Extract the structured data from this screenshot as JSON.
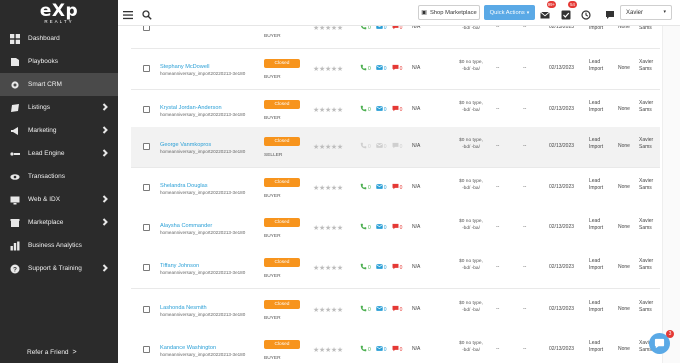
{
  "brand": {
    "logo_main": "eXp",
    "logo_sub": "REALTY"
  },
  "sidebar": {
    "items": [
      {
        "label": "Dashboard",
        "icon": "dashboard-icon",
        "chevron": false,
        "active": false
      },
      {
        "label": "Playbooks",
        "icon": "book-icon",
        "chevron": false,
        "active": false
      },
      {
        "label": "Smart CRM",
        "icon": "gear-icon",
        "chevron": false,
        "active": true
      },
      {
        "label": "Listings",
        "icon": "home-icon",
        "chevron": true,
        "active": false
      },
      {
        "label": "Marketing",
        "icon": "megaphone-icon",
        "chevron": true,
        "active": false
      },
      {
        "label": "Lead Engine",
        "icon": "funnel-icon",
        "chevron": true,
        "active": false
      },
      {
        "label": "Transactions",
        "icon": "eye-icon",
        "chevron": false,
        "active": false
      },
      {
        "label": "Web & IDX",
        "icon": "globe-icon",
        "chevron": true,
        "active": false
      },
      {
        "label": "Marketplace",
        "icon": "store-icon",
        "chevron": true,
        "active": false
      },
      {
        "label": "Business Analytics",
        "icon": "bar-chart-icon",
        "chevron": false,
        "active": false
      },
      {
        "label": "Support & Training",
        "icon": "question-icon",
        "chevron": true,
        "active": false
      }
    ],
    "refer_label": "Refer a Friend",
    "refer_arrow": ">"
  },
  "topbar": {
    "shop_label": "Shop Marketplace",
    "quick_label": "Quick Actions",
    "mail_badge": "99+",
    "tasks_badge": "54",
    "user_name": "Xavier"
  },
  "table": {
    "rows": [
      {
        "name": "",
        "sub": "homeanniversary_import20220213-3e180",
        "status": "",
        "role": "BUYER",
        "type_line1": "$0 no type,",
        "type_line2": "-bd/ -ba/",
        "na": "N/A",
        "dash1": "--",
        "dash2": "--",
        "date": "02/13/2023",
        "source_line1": "Lead",
        "source_line2": "Import",
        "owner": "None",
        "agent_line1": "Xavier",
        "agent_line2": "Sams"
      },
      {
        "name": "Stephany McDowell",
        "sub": "homeanniversary_import20220213-3e180",
        "status": "Closed",
        "role": "BUYER",
        "type_line1": "$0 no type,",
        "type_line2": "-bd/ -ba/",
        "na": "N/A",
        "dash1": "--",
        "dash2": "--",
        "date": "02/13/2023",
        "source_line1": "Lead",
        "source_line2": "Import",
        "owner": "None",
        "agent_line1": "Xavier",
        "agent_line2": "Sams"
      },
      {
        "name": "Krystal Jordan-Anderson",
        "sub": "homeanniversary_import20220213-3e180",
        "status": "Closed",
        "role": "BUYER",
        "type_line1": "$0 no type,",
        "type_line2": "-bd/ -ba/",
        "na": "N/A",
        "dash1": "--",
        "dash2": "--",
        "date": "02/13/2023",
        "source_line1": "Lead",
        "source_line2": "Import",
        "owner": "None",
        "agent_line1": "Xavier",
        "agent_line2": "Sams"
      },
      {
        "name": "George Vanmkopros",
        "sub": "homeanniversary_import20220213-3e180",
        "status": "Closed",
        "role": "SELLER",
        "type_line1": "$0 no type,",
        "type_line2": "-bd/ -ba/",
        "na": "N/A",
        "dash1": "--",
        "dash2": "--",
        "date": "02/13/2023",
        "source_line1": "Lead",
        "source_line2": "Import",
        "owner": "None",
        "agent_line1": "Xavier",
        "agent_line2": "Sams"
      },
      {
        "name": "Shelandra Douglas",
        "sub": "homeanniversary_import20220213-3e180",
        "status": "Closed",
        "role": "BUYER",
        "type_line1": "$0 no type,",
        "type_line2": "-bd/ -ba/",
        "na": "N/A",
        "dash1": "--",
        "dash2": "--",
        "date": "02/13/2023",
        "source_line1": "Lead",
        "source_line2": "Import",
        "owner": "None",
        "agent_line1": "Xavier",
        "agent_line2": "Sams"
      },
      {
        "name": "Alaysha Commander",
        "sub": "homeanniversary_import20220213-3e180",
        "status": "Closed",
        "role": "BUYER",
        "type_line1": "$0 no type,",
        "type_line2": "-bd/ -ba/",
        "na": "N/A",
        "dash1": "--",
        "dash2": "--",
        "date": "02/13/2023",
        "source_line1": "Lead",
        "source_line2": "Import",
        "owner": "None",
        "agent_line1": "Xavier",
        "agent_line2": "Sams"
      },
      {
        "name": "Tiffany Johnson",
        "sub": "homeanniversary_import20220213-3e180",
        "status": "Closed",
        "role": "BUYER",
        "type_line1": "$0 no type,",
        "type_line2": "-bd/ -ba/",
        "na": "N/A",
        "dash1": "--",
        "dash2": "--",
        "date": "02/13/2023",
        "source_line1": "Lead",
        "source_line2": "Import",
        "owner": "None",
        "agent_line1": "Xavier",
        "agent_line2": "Sams"
      },
      {
        "name": "Lashonda Nesmith",
        "sub": "homeanniversary_import20220213-3e180",
        "status": "Closed",
        "role": "BUYER",
        "type_line1": "$0 no type,",
        "type_line2": "-bd/ -ba/",
        "na": "N/A",
        "dash1": "--",
        "dash2": "--",
        "date": "02/13/2023",
        "source_line1": "Lead",
        "source_line2": "Import",
        "owner": "None",
        "agent_line1": "Xavier",
        "agent_line2": "Sams"
      },
      {
        "name": "Kandance Washington",
        "sub": "homeanniversary_import20220213-3e180",
        "status": "Closed",
        "role": "BUYER",
        "type_line1": "$0 no type,",
        "type_line2": "-bd/ -ba/",
        "na": "N/A",
        "dash1": "--",
        "dash2": "--",
        "date": "02/13/2023",
        "source_line1": "Lead",
        "source_line2": "Import",
        "owner": "None",
        "agent_line1": "Xavier",
        "agent_line2": "Sams"
      }
    ],
    "icons": {
      "call": {
        "icon": "phone-icon",
        "count": "0",
        "color": "#4caf50"
      },
      "email": {
        "icon": "mail-icon",
        "count": "0",
        "color": "#2a9fd6"
      },
      "text": {
        "icon": "chat-bubble-icon",
        "count": "0",
        "color": "#e53935"
      }
    },
    "stars": "★★★★★"
  },
  "chat": {
    "badge": "3"
  }
}
